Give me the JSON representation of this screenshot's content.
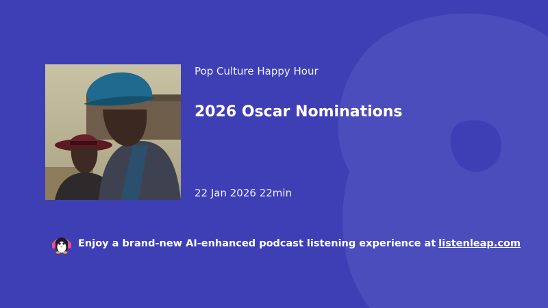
{
  "podcast": {
    "show_name": "Pop Culture Happy Hour",
    "episode_title": "2026 Oscar Nominations",
    "date": "22 Jan 2026",
    "duration": "22min"
  },
  "promo": {
    "text": "Enjoy a brand-new AI-enhanced podcast listening experience at",
    "link_text": "listenleap.com",
    "logo_icon": "penguin-headphones-icon"
  },
  "colors": {
    "background": "#3e3fb5",
    "text": "#ffffff",
    "watermark": "#5759c4"
  }
}
